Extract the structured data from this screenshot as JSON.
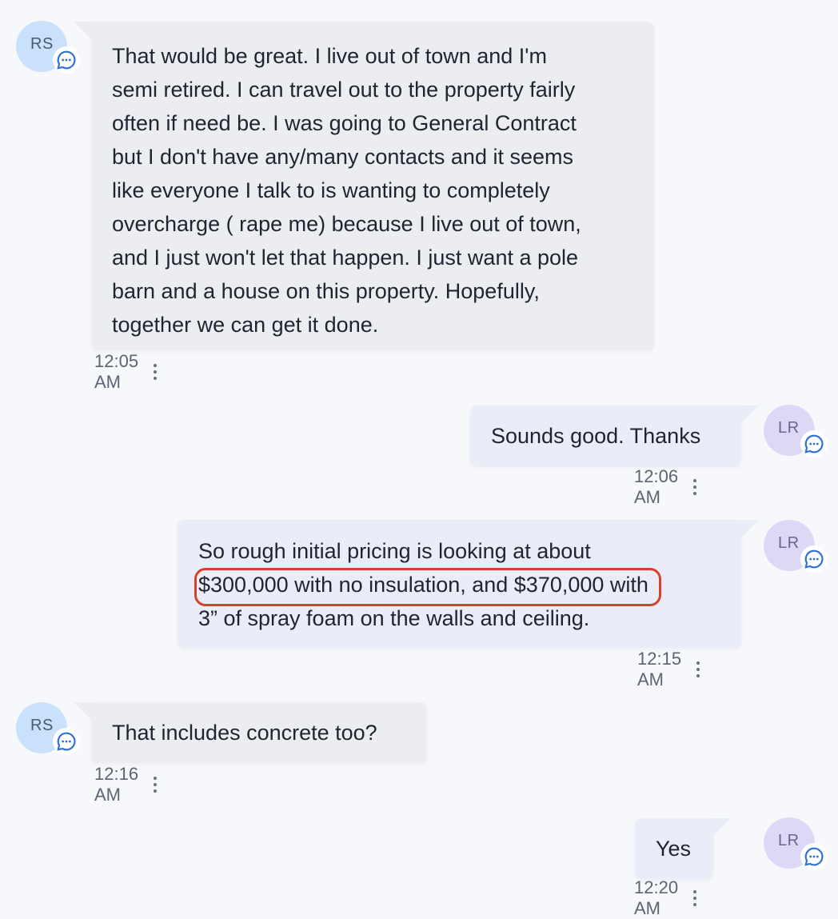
{
  "messages": [
    {
      "sender_initials": "RS",
      "text_lines": [
        "That would be great. I live out of town and I'm",
        "semi retired. I can travel out to the property fairly",
        "often if need be. I was going to General Contract",
        "but I don't have any/many contacts and it seems",
        "like everyone I talk to is wanting to completely",
        "overcharge ( rape me) because I live out of town,",
        "and I just won't let that happen. I just want a pole",
        "barn and a house on this property. Hopefully,",
        "together we can get it done."
      ],
      "time": "12:05 AM"
    },
    {
      "sender_initials": "LR",
      "text": "Sounds good. Thanks",
      "time": "12:06 AM"
    },
    {
      "sender_initials": "LR",
      "text_lines": [
        "So rough initial pricing is looking at about",
        "$300,000 with no insulation, and $370,000 with",
        "3” of spray foam on the walls and ceiling."
      ],
      "time": "12:15 AM"
    },
    {
      "sender_initials": "RS",
      "text": "That includes concrete too?",
      "time": "12:16 AM"
    },
    {
      "sender_initials": "LR",
      "text": "Yes",
      "time": "12:20 AM"
    }
  ],
  "colors": {
    "incoming_bubble": "#ecedf1",
    "outgoing_bubble": "#eaedf8",
    "avatar_rs": "#c9e1fb",
    "avatar_lr": "#ddd8f6",
    "badge_icon": "#2f6fd6",
    "highlight": "#d6412c"
  },
  "icons": {
    "avatar_badge": "chat-bubble-icon",
    "message_menu": "more-vertical-icon"
  }
}
